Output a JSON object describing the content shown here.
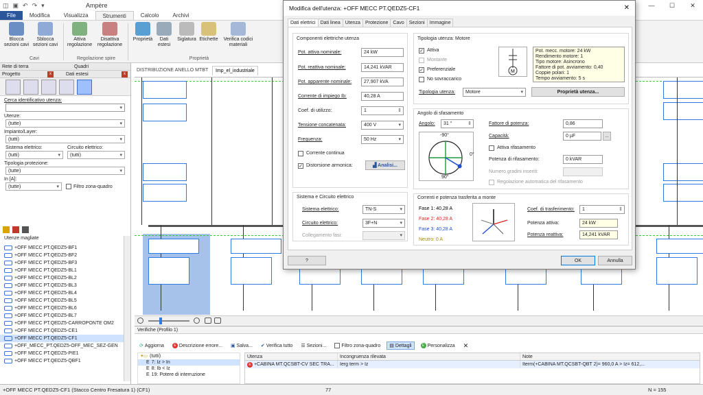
{
  "app": {
    "title": "Ampère",
    "menu": [
      "File",
      "Modifica",
      "Visualizza",
      "Strumenti",
      "Calcolo",
      "Archivi"
    ],
    "active_menu": "Strumenti"
  },
  "ribbon": {
    "buttons": [
      {
        "label": "Blocca\nsezioni cavi"
      },
      {
        "label": "Sblocca\nsezioni cavi"
      },
      {
        "label": "Attiva\nregolazione"
      },
      {
        "label": "Disattiva\nregolazione"
      },
      {
        "label": "Proprietà"
      },
      {
        "label": "Dati\nestesi"
      },
      {
        "label": "Siglatura"
      },
      {
        "label": "Etichette"
      },
      {
        "label": "Verifica codici\nmateriali"
      }
    ],
    "groups": [
      "Cavi",
      "Regolazione spire",
      "Proprietà"
    ]
  },
  "left_panel": {
    "tab1": "Rete di terra",
    "tab2": "Quadri",
    "tab3": "Progetto",
    "tab4": "Dati estesi",
    "search_label": "Cerca identificativo utenza:",
    "utenze_label": "Utenze:",
    "utenze_value": "(tutte)",
    "impianto_label": "Impianto/Layer:",
    "impianto_value": "(tutti)",
    "sistema_label": "Sistema elettrico:",
    "sistema_value": "(tutti)",
    "circuito_label": "Circuito elettrico:",
    "circuito_value": "(tutti)",
    "tipologia_label": "Tipologia protezione:",
    "tipologia_value": "(tutte)",
    "in_label": "In [A]:",
    "in_value": "(tutte)",
    "filtro_label": "Filtro zona-quadro",
    "utenze_magliate": "Utenze magliate",
    "tree": [
      "+OFF MECC PT.QEDZ5-BF1",
      "+OFF MECC PT.QEDZ5-BF2",
      "+OFF MECC PT.QEDZ5-BF3",
      "+OFF MECC PT.QEDZ5-BL1",
      "+OFF MECC PT.QEDZ5-BL2",
      "+OFF MECC PT.QEDZ5-BL3",
      "+OFF MECC PT.QEDZ5-BL4",
      "+OFF MECC PT.QEDZ5-BL5",
      "+OFF MECC PT.QEDZ5-BL6",
      "+OFF MECC PT.QEDZ5-BL7",
      "+OFF MECC PT.QEDZ5-CARROPONTE OM2",
      "+OFF MECC PT.QEDZ5-CE1",
      "+OFF MECC PT.QEDZ5-CF1",
      "+OFF_MECC_PT.QEDZ5-OFF_MEC_SEZ-GEN",
      "+OFF MECC PT.QEDZ5-PIE1",
      "+OFF MECC PT.QEDZ5-QBF1"
    ],
    "tree_selected": 12
  },
  "doc_tabs": [
    "DISTRIBUZIONE ANELLO MTBT",
    "Imp_el_industriale"
  ],
  "verifiche": {
    "title": "Verifiche (Profilo 1)",
    "toolbar": [
      "Aggiorna",
      "Descrizione errore...",
      "Salva...",
      "Verifica tutto",
      "Sezioni...",
      "Filtro zona-quadro",
      "Dettagli",
      "Personalizza"
    ],
    "tree_root": "(tutti)",
    "tree_items": [
      "7: Iz > In",
      "8: Ib < Iz",
      "19: Potere di interruzione"
    ],
    "columns": [
      "Utenza",
      "Incongruenza rilevata",
      "Note"
    ],
    "row": {
      "utenza": "+CABINA MT.QCSBT-CV SEC TRA...",
      "incongruenza": "Ierg term > Iz",
      "note": "Iterm(+CABINA MT.QCSBT-QBT 2)= 960,0 A > Iz= 612,..."
    }
  },
  "status": {
    "left": "+OFF MECC PT.QEDZ5-CF1 (Stacco Centro Fresatura 1) (CF1)",
    "mid": "77",
    "right": "N = 155"
  },
  "dialog": {
    "title": "Modifica dell'utenza: +OFF MECC PT.QEDZ5-CF1",
    "tabs": [
      "Dati elettrici",
      "Dati linea",
      "Utenza",
      "Protezione",
      "Cavo",
      "Sezioni",
      "Immagine"
    ],
    "comp": {
      "title": "Componenti elettriche utenza",
      "pot_attiva_label": "Pot. attiva nominale:",
      "pot_attiva": "24 kW",
      "pot_reattiva_label": "Pot. reattiva nominale:",
      "pot_reattiva": "14,241 kVAR",
      "pot_apparente_label": "Pot. apparente nominale:",
      "pot_apparente": "27,907 kVA",
      "corrente_label": "Corrente di impiego Ib:",
      "corrente": "40,28 A",
      "coef_label": "Coef. di utilizzo:",
      "coef": "1",
      "tensione_label": "Tensione concatenata:",
      "tensione": "400 V",
      "frequenza_label": "Frequenza:",
      "frequenza": "50 Hz",
      "corrente_continua": "Corrente continua",
      "distorsione": "Distorsione armonica:",
      "analisi": "Analisi..."
    },
    "tipologia": {
      "title": "Tipologia utenza: Motore",
      "attiva": "Attiva",
      "montante": "Montante",
      "preferenziale": "Preferenziale",
      "no_sovraccarico": "No sovraccarico",
      "tipologia_label": "Tipologia utenza:",
      "tipologia_value": "Motore",
      "proprieta_btn": "Proprietà utenza...",
      "info": [
        "Pot. mecc. motore: 24 kW",
        "Rendimento motore: 1",
        "Tipo motore: Asincrono",
        "Fattore di pot. avviamento: 0,40",
        "Coppie polari: 1",
        "Tempo avviamento: 5 s"
      ]
    },
    "sistema": {
      "title": "Sistema e Circuito elettrico",
      "sistema_label": "Sistema elettrico:",
      "sistema_value": "TN-S",
      "circuito_label": "Circuito elettrico:",
      "circuito_value": "3F+N",
      "collegamento_label": "Collegamento fasi:"
    },
    "angolo": {
      "title": "Angolo di sfasamento",
      "angolo_label": "Angolo:",
      "angolo_value": "31 °",
      "deg_top": "-90°",
      "deg_right": "0°",
      "deg_bottom": "90°",
      "fattore_label": "Fattore di potenza:",
      "fattore_value": "0,86",
      "capacita_label": "Capacità:",
      "capacita_value": "0 µF",
      "attiva_rifas": "Attiva rifasamento",
      "potenza_rifas_label": "Potenza di rifasamento:",
      "potenza_rifas_value": "0 kVAR",
      "gradini_label": "Numero gradini inseriti:",
      "regolazione": "Regolazione automatica del rifasamento"
    },
    "correnti": {
      "title": "Correnti e potenza trasferita a monte",
      "fase1": "Fase 1: 40,28 A",
      "fase2": "Fase 2: 40,28 A",
      "fase3": "Fase 3: 40,28 A",
      "neutro": "Neutro: 0 A",
      "coef_tras_label": "Coef. di trasferimento:",
      "coef_tras": "1",
      "pot_attiva_label": "Potenza attiva:",
      "pot_attiva": "24 kW",
      "pot_reattiva_label": "Potenza reattiva:",
      "pot_reattiva": "14,241 kVAR"
    },
    "help": "?",
    "ok": "OK",
    "cancel": "Annulla"
  },
  "colors": {
    "accent": "#2b579a",
    "fase1": "#000000",
    "fase2": "#e02020",
    "fase3": "#1f4fd0",
    "neutro": "#a08a00",
    "readonly_field": "#ffffe6"
  },
  "angle_deg": 31
}
